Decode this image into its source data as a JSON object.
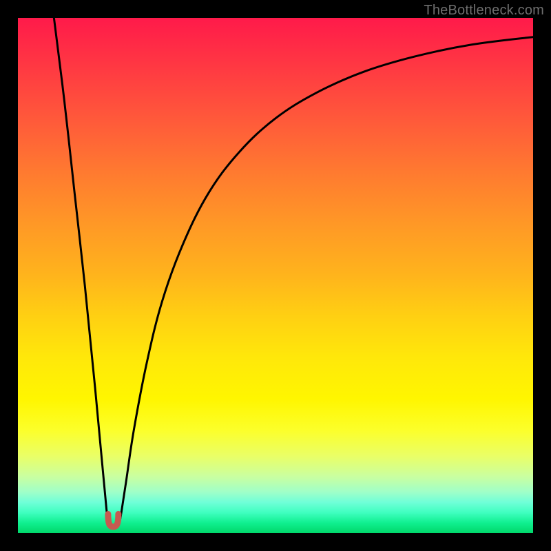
{
  "watermark": "TheBottleneck.com",
  "chart_data": {
    "type": "line",
    "title": "",
    "xlabel": "",
    "ylabel": "",
    "xlim": [
      0,
      100
    ],
    "ylim": [
      0,
      100
    ],
    "grid": false,
    "legend": false,
    "background_gradient": {
      "top": "#ff1a4a",
      "middle": "#ffe80a",
      "bottom": "#00d86a"
    },
    "series": [
      {
        "name": "left-branch",
        "x": [
          7,
          9,
          11,
          13,
          15,
          16.5,
          17.3,
          17.5
        ],
        "y": [
          100,
          84,
          66,
          48,
          28,
          12,
          3.5,
          2
        ]
      },
      {
        "name": "right-branch",
        "x": [
          19.7,
          20,
          21,
          22.5,
          25,
          28,
          32,
          37,
          43,
          50,
          58,
          67,
          77,
          88,
          100
        ],
        "y": [
          2,
          3.5,
          10,
          20,
          33,
          45,
          56,
          66,
          74,
          80.5,
          85.5,
          89.5,
          92.5,
          94.8,
          96.3
        ]
      },
      {
        "name": "valley-marker",
        "type": "marker",
        "x": 18.5,
        "y": 1.5,
        "width_pct": 2.0,
        "height_pct": 2.2,
        "color": "#c55a50"
      }
    ]
  }
}
